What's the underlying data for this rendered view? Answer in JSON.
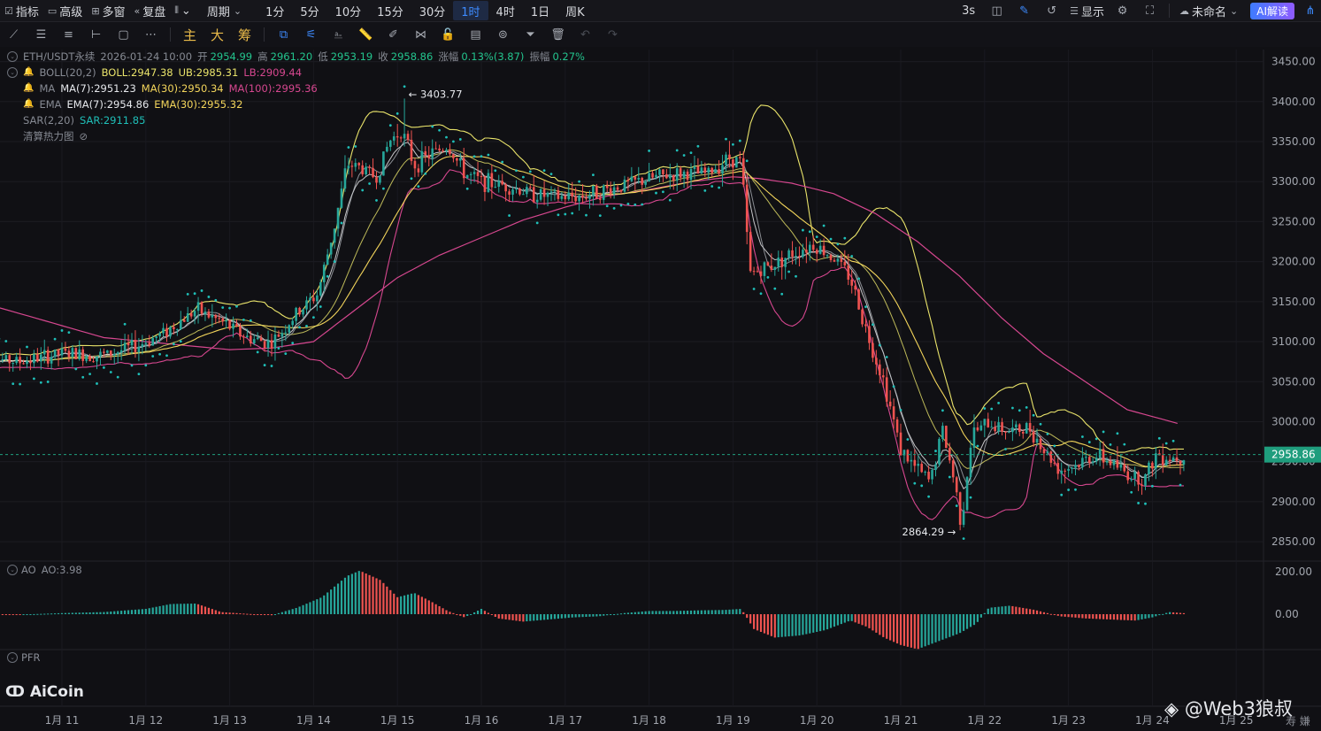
{
  "toolbar": {
    "items": [
      {
        "icon": "checkbox-icon",
        "label": "指标"
      },
      {
        "icon": "window-icon",
        "label": "高级"
      },
      {
        "icon": "grid-icon",
        "label": "多窗"
      },
      {
        "icon": "rewind-icon",
        "label": "复盘"
      },
      {
        "icon": "candle-type-icon",
        "label": "⌄"
      }
    ],
    "period_label": "周期",
    "timeframes": [
      "1分",
      "5分",
      "10分",
      "15分",
      "30分",
      "1时",
      "4时",
      "1日",
      "周K"
    ],
    "active_timeframe": "1时",
    "right": {
      "interval": "3s",
      "display_label": "显示",
      "layout_name": "未命名",
      "ai_label": "AI解读"
    }
  },
  "drawing_tools": {
    "icons": [
      "trendline-icon",
      "hline-icon",
      "channel-icon",
      "ray-icon",
      "rect-icon",
      "dots-icon"
    ],
    "chips": [
      "主",
      "大",
      "筹"
    ],
    "icons2": [
      "compare-icon",
      "measure-icon",
      "text-tool-icon",
      "ruler-icon",
      "brush-icon",
      "pattern-icon",
      "lock-icon",
      "template-icon",
      "magnet-icon",
      "filter-icon",
      "trash-icon",
      "undo-icon",
      "redo-icon"
    ]
  },
  "legend": {
    "symbol": "ETH/USDT永续",
    "time": "2026-01-24 10:00",
    "ohlc": [
      {
        "label": "开",
        "value": "2954.99"
      },
      {
        "label": "高",
        "value": "2961.20"
      },
      {
        "label": "低",
        "value": "2953.19"
      },
      {
        "label": "收",
        "value": "2958.86"
      },
      {
        "label": "涨幅",
        "value": "0.13%(3.87)"
      },
      {
        "label": "振幅",
        "value": "0.27%"
      }
    ],
    "boll": {
      "name": "BOLL(20,2)",
      "mid": "BOLL:2947.38",
      "ub": "UB:2985.31",
      "lb": "LB:2909.44"
    },
    "ma": {
      "name": "MA",
      "v7": "MA(7):2951.23",
      "v30": "MA(30):2950.34",
      "v100": "MA(100):2995.36"
    },
    "ema": {
      "name": "EMA",
      "v7": "EMA(7):2954.86",
      "v30": "EMA(30):2955.32"
    },
    "sar": {
      "name": "SAR(2,20)",
      "value": "SAR:2911.85"
    },
    "heatmap": "清算热力图"
  },
  "colors": {
    "up": "#26a69a",
    "down": "#ef5350",
    "boll": "#e9e36a",
    "ma7": "#ffffff",
    "ma30": "#f3d55b",
    "ma100": "#d6478f",
    "sar": "#1fbfb8",
    "price_tag": "#1f9d7d"
  },
  "ao_pane": {
    "label": "AO",
    "value": "AO:3.98"
  },
  "pfr_pane": {
    "label": "PFR"
  },
  "logo": "AiCoin",
  "watermark": "@Web3狼叔",
  "watermark_small": "寿 嫌",
  "chart_data": {
    "type": "candlestick",
    "symbol": "ETH/USDT永续",
    "interval": "1h",
    "y_axis": {
      "ticks": [
        3450,
        3400,
        3350,
        3300,
        3250,
        3200,
        3150,
        3100,
        3050,
        3000,
        2950,
        2900,
        2850
      ],
      "range": [
        2828,
        3465
      ]
    },
    "x_axis": {
      "labels": [
        "1月 11",
        "1月 12",
        "1月 13",
        "1月 14",
        "1月 15",
        "1月 16",
        "1月 17",
        "1月 18",
        "1月 19",
        "1月 20",
        "1月 21",
        "1月 22",
        "1月 23",
        "1月 24",
        "1月 25"
      ]
    },
    "last_price": "2958.86",
    "annotations": [
      {
        "text": "3403.77",
        "type": "high",
        "day": 15.1,
        "price": 3403.77
      },
      {
        "text": "2864.29",
        "type": "low",
        "day": 21.7,
        "price": 2864.29
      }
    ],
    "price_path": [
      [
        10.0,
        3080
      ],
      [
        10.5,
        3075
      ],
      [
        11.0,
        3085
      ],
      [
        11.5,
        3083
      ],
      [
        11.9,
        3095
      ],
      [
        12.2,
        3110
      ],
      [
        12.6,
        3140
      ],
      [
        12.9,
        3125
      ],
      [
        13.2,
        3105
      ],
      [
        13.5,
        3098
      ],
      [
        13.8,
        3135
      ],
      [
        14.05,
        3160
      ],
      [
        14.25,
        3245
      ],
      [
        14.4,
        3322
      ],
      [
        14.55,
        3318
      ],
      [
        14.75,
        3305
      ],
      [
        14.9,
        3350
      ],
      [
        15.05,
        3365
      ],
      [
        15.2,
        3320
      ],
      [
        15.4,
        3335
      ],
      [
        15.6,
        3345
      ],
      [
        15.8,
        3310
      ],
      [
        16.0,
        3300
      ],
      [
        16.3,
        3295
      ],
      [
        16.6,
        3285
      ],
      [
        16.9,
        3280
      ],
      [
        17.2,
        3282
      ],
      [
        17.5,
        3290
      ],
      [
        17.8,
        3298
      ],
      [
        18.1,
        3306
      ],
      [
        18.4,
        3310
      ],
      [
        18.7,
        3310
      ],
      [
        18.95,
        3330
      ],
      [
        19.1,
        3325
      ],
      [
        19.2,
        3185
      ],
      [
        19.45,
        3195
      ],
      [
        19.7,
        3210
      ],
      [
        19.95,
        3222
      ],
      [
        20.2,
        3205
      ],
      [
        20.4,
        3180
      ],
      [
        20.6,
        3110
      ],
      [
        20.8,
        3050
      ],
      [
        21.0,
        2965
      ],
      [
        21.15,
        2945
      ],
      [
        21.35,
        2925
      ],
      [
        21.5,
        2990
      ],
      [
        21.65,
        2920
      ],
      [
        21.72,
        2872
      ],
      [
        21.85,
        2985
      ],
      [
        22.05,
        2998
      ],
      [
        22.3,
        2988
      ],
      [
        22.55,
        2992
      ],
      [
        22.7,
        2965
      ],
      [
        22.9,
        2940
      ],
      [
        23.1,
        2946
      ],
      [
        23.3,
        2958
      ],
      [
        23.5,
        2950
      ],
      [
        23.7,
        2935
      ],
      [
        23.9,
        2928
      ],
      [
        24.05,
        2960
      ],
      [
        24.2,
        2955
      ],
      [
        24.4,
        2958
      ]
    ],
    "ma100_path": [
      [
        10.0,
        3150
      ],
      [
        10.5,
        3135
      ],
      [
        11.0,
        3120
      ],
      [
        11.5,
        3105
      ],
      [
        12.0,
        3100
      ],
      [
        12.5,
        3095
      ],
      [
        13.0,
        3090
      ],
      [
        13.5,
        3092
      ],
      [
        14.0,
        3100
      ],
      [
        14.5,
        3140
      ],
      [
        15.0,
        3180
      ],
      [
        15.5,
        3208
      ],
      [
        16.0,
        3230
      ],
      [
        16.5,
        3252
      ],
      [
        17.0,
        3268
      ],
      [
        17.5,
        3282
      ],
      [
        18.0,
        3290
      ],
      [
        18.5,
        3300
      ],
      [
        19.0,
        3306
      ],
      [
        19.3,
        3304
      ],
      [
        19.7,
        3298
      ],
      [
        20.2,
        3285
      ],
      [
        20.7,
        3260
      ],
      [
        21.2,
        3225
      ],
      [
        21.7,
        3182
      ],
      [
        22.2,
        3130
      ],
      [
        22.7,
        3085
      ],
      [
        23.2,
        3050
      ],
      [
        23.7,
        3015
      ],
      [
        24.4,
        2995
      ]
    ],
    "ao_series": [
      [
        10.0,
        3
      ],
      [
        10.5,
        -2
      ],
      [
        11.0,
        5
      ],
      [
        11.5,
        10
      ],
      [
        12.0,
        25
      ],
      [
        12.3,
        48
      ],
      [
        12.6,
        50
      ],
      [
        12.9,
        10
      ],
      [
        13.2,
        2
      ],
      [
        13.5,
        -5
      ],
      [
        13.8,
        30
      ],
      [
        14.1,
        80
      ],
      [
        14.4,
        180
      ],
      [
        14.55,
        205
      ],
      [
        14.8,
        160
      ],
      [
        15.0,
        80
      ],
      [
        15.2,
        100
      ],
      [
        15.4,
        60
      ],
      [
        15.6,
        15
      ],
      [
        15.8,
        -15
      ],
      [
        16.0,
        25
      ],
      [
        16.2,
        -20
      ],
      [
        16.5,
        -35
      ],
      [
        16.8,
        -25
      ],
      [
        17.1,
        -15
      ],
      [
        17.4,
        -10
      ],
      [
        17.7,
        5
      ],
      [
        18.0,
        15
      ],
      [
        18.3,
        15
      ],
      [
        18.6,
        18
      ],
      [
        18.9,
        20
      ],
      [
        19.1,
        25
      ],
      [
        19.25,
        -70
      ],
      [
        19.5,
        -110
      ],
      [
        19.8,
        -100
      ],
      [
        20.1,
        -75
      ],
      [
        20.4,
        -30
      ],
      [
        20.6,
        -60
      ],
      [
        20.8,
        -110
      ],
      [
        21.0,
        -145
      ],
      [
        21.2,
        -165
      ],
      [
        21.5,
        -120
      ],
      [
        21.7,
        -90
      ],
      [
        21.9,
        -45
      ],
      [
        22.05,
        30
      ],
      [
        22.3,
        40
      ],
      [
        22.6,
        20
      ],
      [
        22.9,
        -10
      ],
      [
        23.2,
        -20
      ],
      [
        23.5,
        -25
      ],
      [
        23.8,
        -30
      ],
      [
        24.0,
        -15
      ],
      [
        24.2,
        10
      ],
      [
        24.4,
        4
      ]
    ]
  }
}
